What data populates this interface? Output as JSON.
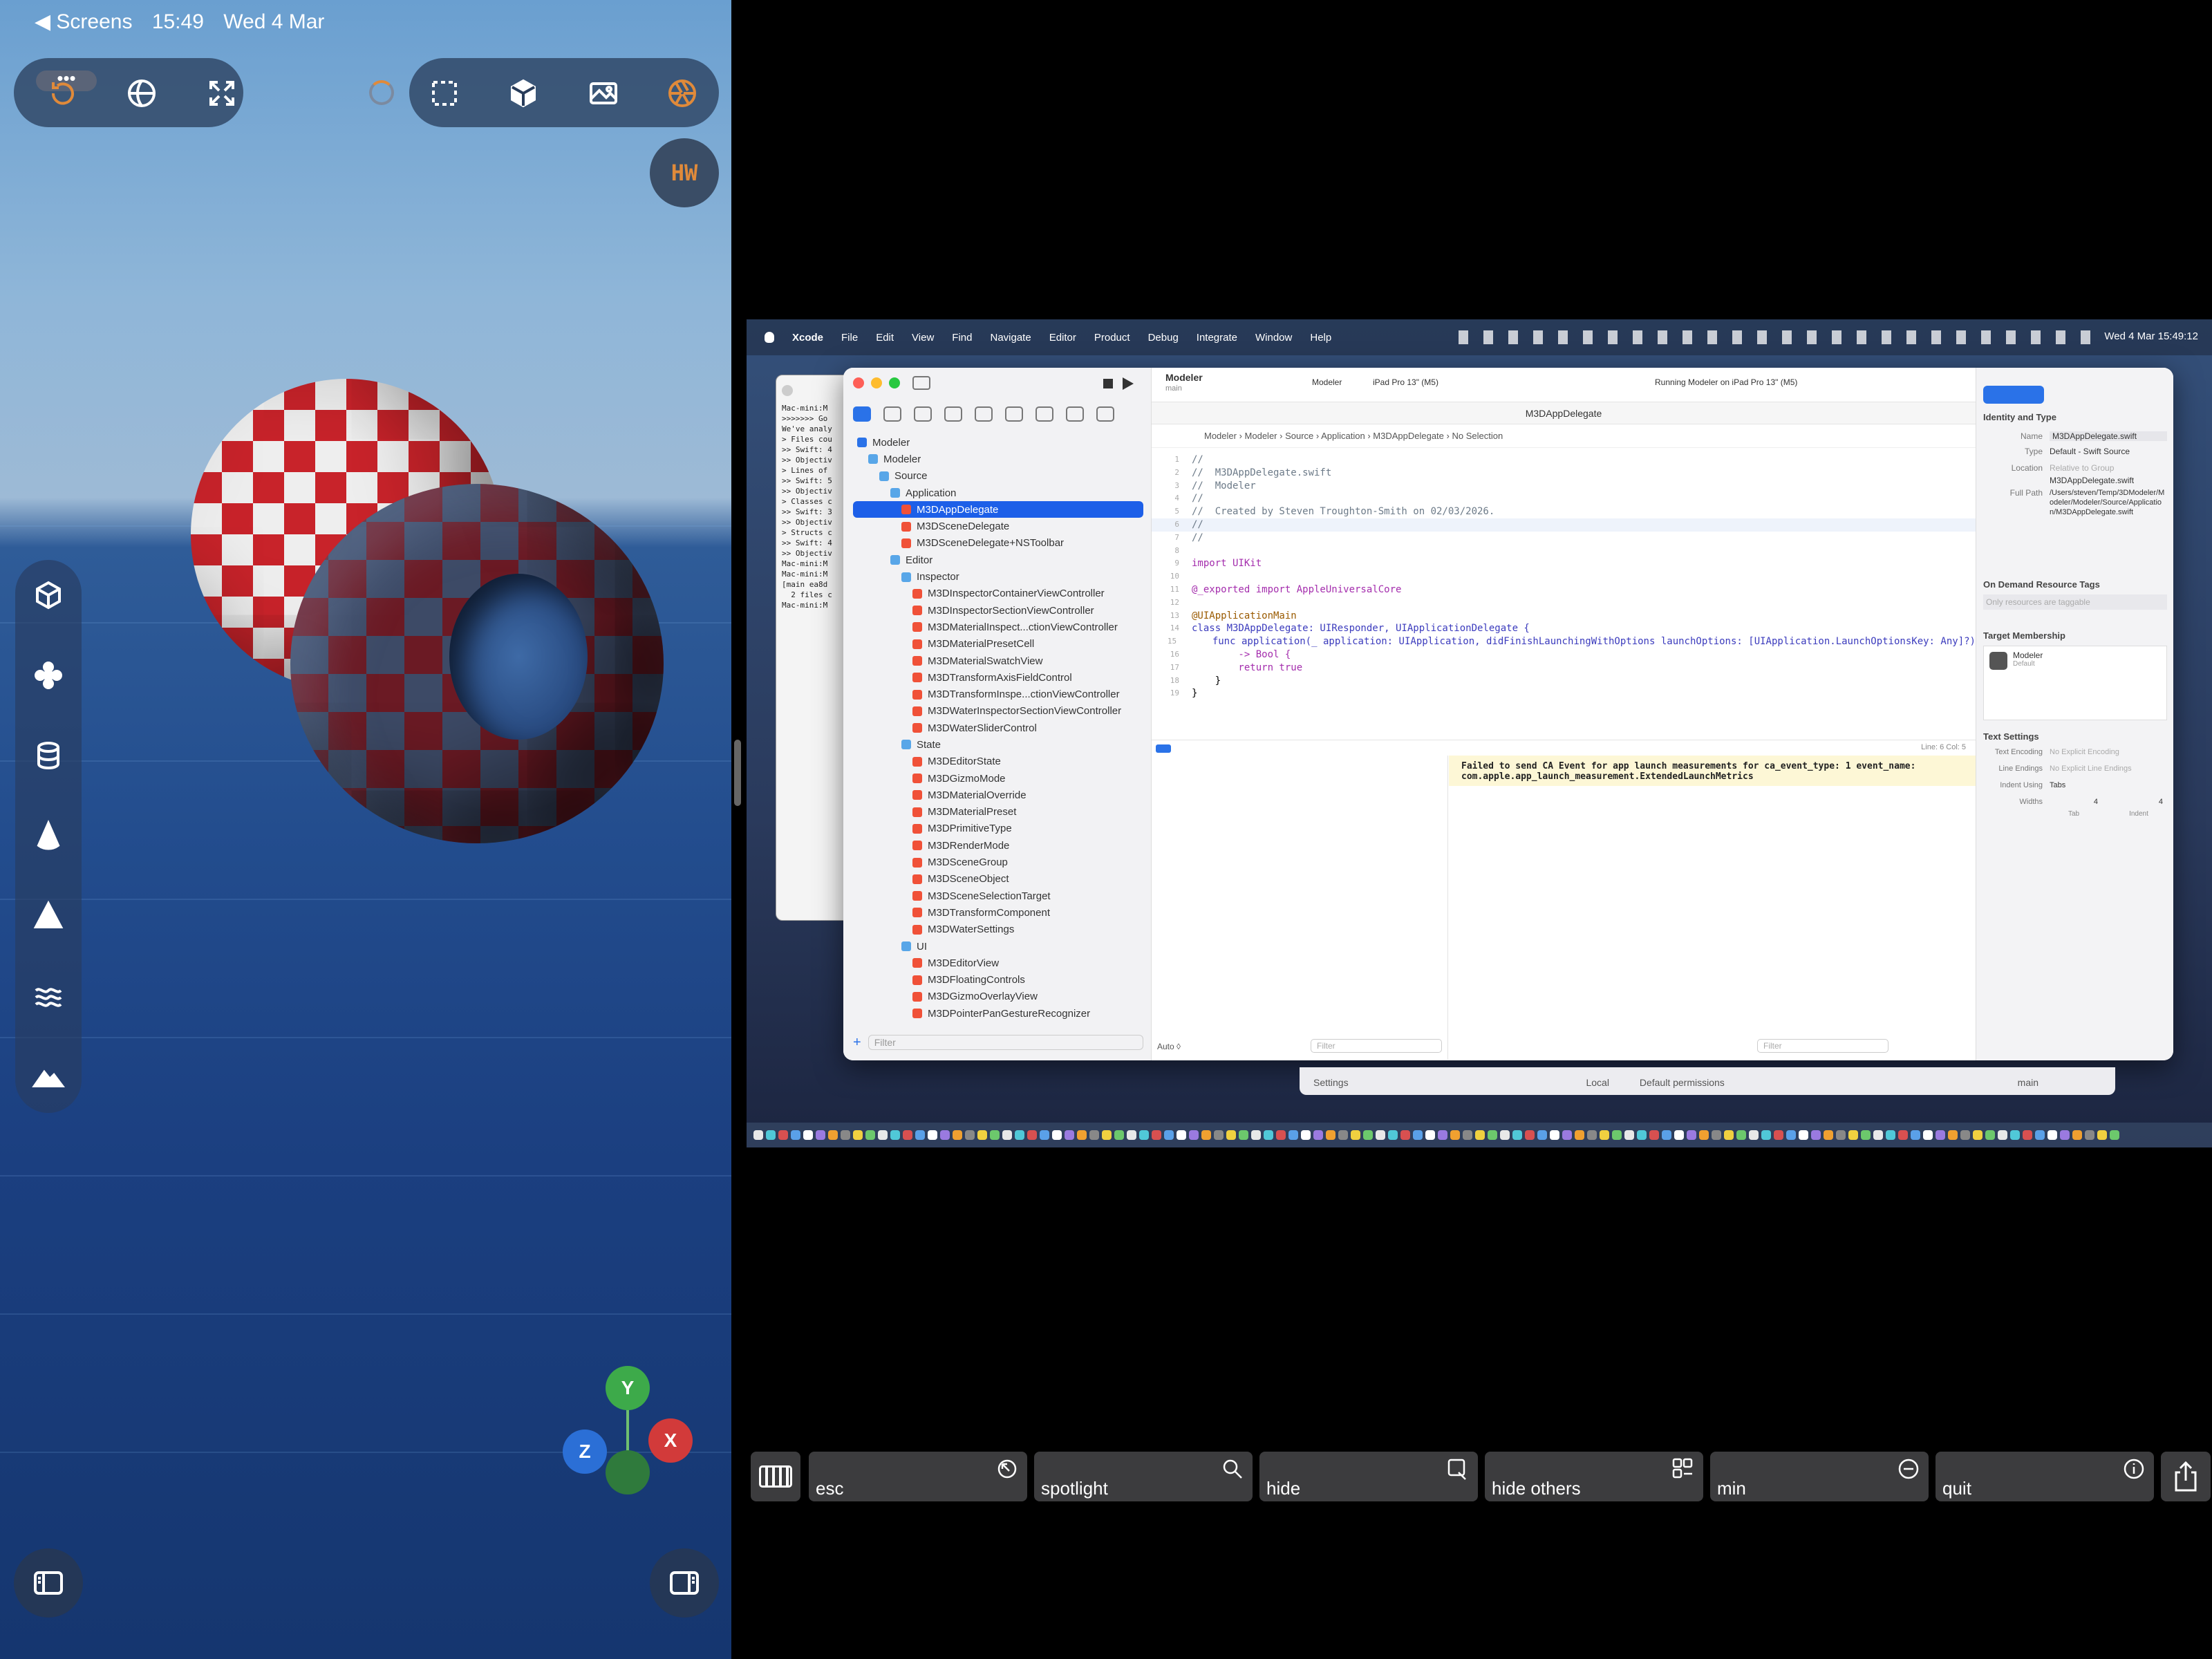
{
  "status_bar": {
    "back_app": "◀ Screens",
    "time": "15:49",
    "date": "Wed 4 Mar"
  },
  "viewport": {
    "avatar_initials": "HW",
    "axes": {
      "y": "Y",
      "x": "X",
      "z": "Z"
    }
  },
  "mac_menubar": {
    "apple": "",
    "items": [
      "Xcode",
      "File",
      "Edit",
      "View",
      "Find",
      "Navigate",
      "Editor",
      "Product",
      "Debug",
      "Integrate",
      "Window",
      "Help"
    ],
    "clock": "Wed 4 Mar 15:49:12"
  },
  "xcode": {
    "project": {
      "name": "Modeler",
      "branch": "main"
    },
    "scheme": "Modeler",
    "destination": "iPad Pro 13\" (M5)",
    "run_status": "Running Modeler on iPad Pro 13\" (M5)",
    "tab_title": "M3DAppDelegate",
    "jump_bar": [
      "Modeler",
      "Modeler",
      "Source",
      "Application",
      "M3DAppDelegate",
      "No Selection"
    ],
    "tree": [
      {
        "label": "Modeler",
        "depth": 0,
        "kind": "project"
      },
      {
        "label": "Modeler",
        "depth": 1,
        "kind": "folder"
      },
      {
        "label": "Source",
        "depth": 2,
        "kind": "folder"
      },
      {
        "label": "Application",
        "depth": 3,
        "kind": "folder"
      },
      {
        "label": "M3DAppDelegate",
        "depth": 4,
        "kind": "swift",
        "selected": true
      },
      {
        "label": "M3DSceneDelegate",
        "depth": 4,
        "kind": "swift"
      },
      {
        "label": "M3DSceneDelegate+NSToolbar",
        "depth": 4,
        "kind": "swift"
      },
      {
        "label": "Editor",
        "depth": 3,
        "kind": "folder"
      },
      {
        "label": "Inspector",
        "depth": 4,
        "kind": "folder"
      },
      {
        "label": "M3DInspectorContainerViewController",
        "depth": 5,
        "kind": "swift"
      },
      {
        "label": "M3DInspectorSectionViewController",
        "depth": 5,
        "kind": "swift"
      },
      {
        "label": "M3DMaterialInspect...ctionViewController",
        "depth": 5,
        "kind": "swift"
      },
      {
        "label": "M3DMaterialPresetCell",
        "depth": 5,
        "kind": "swift"
      },
      {
        "label": "M3DMaterialSwatchView",
        "depth": 5,
        "kind": "swift"
      },
      {
        "label": "M3DTransformAxisFieldControl",
        "depth": 5,
        "kind": "swift"
      },
      {
        "label": "M3DTransformInspe...ctionViewController",
        "depth": 5,
        "kind": "swift"
      },
      {
        "label": "M3DWaterInspectorSectionViewController",
        "depth": 5,
        "kind": "swift"
      },
      {
        "label": "M3DWaterSliderControl",
        "depth": 5,
        "kind": "swift"
      },
      {
        "label": "State",
        "depth": 4,
        "kind": "folder"
      },
      {
        "label": "M3DEditorState",
        "depth": 5,
        "kind": "swift"
      },
      {
        "label": "M3DGizmoMode",
        "depth": 5,
        "kind": "swift"
      },
      {
        "label": "M3DMaterialOverride",
        "depth": 5,
        "kind": "swift"
      },
      {
        "label": "M3DMaterialPreset",
        "depth": 5,
        "kind": "swift"
      },
      {
        "label": "M3DPrimitiveType",
        "depth": 5,
        "kind": "swift"
      },
      {
        "label": "M3DRenderMode",
        "depth": 5,
        "kind": "swift"
      },
      {
        "label": "M3DSceneGroup",
        "depth": 5,
        "kind": "swift"
      },
      {
        "label": "M3DSceneObject",
        "depth": 5,
        "kind": "swift"
      },
      {
        "label": "M3DSceneSelectionTarget",
        "depth": 5,
        "kind": "swift"
      },
      {
        "label": "M3DTransformComponent",
        "depth": 5,
        "kind": "swift"
      },
      {
        "label": "M3DWaterSettings",
        "depth": 5,
        "kind": "swift"
      },
      {
        "label": "UI",
        "depth": 4,
        "kind": "folder"
      },
      {
        "label": "M3DEditorView",
        "depth": 5,
        "kind": "swift"
      },
      {
        "label": "M3DFloatingControls",
        "depth": 5,
        "kind": "swift"
      },
      {
        "label": "M3DGizmoOverlayView",
        "depth": 5,
        "kind": "swift"
      },
      {
        "label": "M3DPointerPanGestureRecognizer",
        "depth": 5,
        "kind": "swift"
      }
    ],
    "filter_placeholder": "Filter",
    "code_lines": [
      {
        "n": "1",
        "t": "//",
        "c": "cm"
      },
      {
        "n": "2",
        "t": "//  M3DAppDelegate.swift",
        "c": "cm"
      },
      {
        "n": "3",
        "t": "//  Modeler",
        "c": "cm"
      },
      {
        "n": "4",
        "t": "//",
        "c": "cm"
      },
      {
        "n": "5",
        "t": "//  Created by Steven Troughton-Smith on 02/03/2026.",
        "c": "cm"
      },
      {
        "n": "6",
        "t": "//",
        "c": "cm"
      },
      {
        "n": "7",
        "t": "//",
        "c": "cm"
      },
      {
        "n": "8",
        "t": "",
        "c": ""
      },
      {
        "n": "9",
        "t": "import UIKit",
        "c": "kw"
      },
      {
        "n": "10",
        "t": "",
        "c": ""
      },
      {
        "n": "11",
        "t": "@_exported import AppleUniversalCore",
        "c": "kw"
      },
      {
        "n": "12",
        "t": "",
        "c": ""
      },
      {
        "n": "13",
        "t": "@UIApplicationMain",
        "c": "at"
      },
      {
        "n": "14",
        "t": "class M3DAppDelegate: UIResponder, UIApplicationDelegate {",
        "c": "ty"
      },
      {
        "n": "15",
        "t": "    func application(_ application: UIApplication, didFinishLaunchingWithOptions launchOptions: [UIApplication.LaunchOptionsKey: Any]?)",
        "c": "ty"
      },
      {
        "n": "16",
        "t": "        -> Bool {",
        "c": "kw"
      },
      {
        "n": "17",
        "t": "        return true",
        "c": "kw"
      },
      {
        "n": "18",
        "t": "    }",
        "c": ""
      },
      {
        "n": "19",
        "t": "}",
        "c": ""
      }
    ],
    "cursor_pos": "Line: 6  Col: 5",
    "console_message": "Failed to send CA Event for app launch measurements for ca_event_type: 1 event_name:\ncom.apple.app_launch_measurement.ExtendedLaunchMetrics",
    "debug_auto": "Auto ◊",
    "debug_filter": "Filter",
    "inspector": {
      "section_identity": "Identity and Type",
      "name_label": "Name",
      "name_value": "M3DAppDelegate.swift",
      "type_label": "Type",
      "type_value": "Default - Swift Source",
      "location_label": "Location",
      "location_value": "Relative to Group",
      "location_file": "M3DAppDelegate.swift",
      "fullpath_label": "Full Path",
      "fullpath_value": "/Users/steven/Temp/3DModeler/Modeler/Modeler/Source/Application/M3DAppDelegate.swift",
      "section_ondemand": "On Demand Resource Tags",
      "ondemand_placeholder": "Only resources are taggable",
      "section_target": "Target Membership",
      "target_name": "Modeler",
      "target_sub": "Default",
      "section_text": "Text Settings",
      "encoding_label": "Text Encoding",
      "encoding_value": "No Explicit Encoding",
      "endings_label": "Line Endings",
      "endings_value": "No Explicit Line Endings",
      "indent_label": "Indent Using",
      "indent_value": "Tabs",
      "widths_label": "Widths",
      "tab_width": "4",
      "indent_width": "4",
      "tab_caption": "Tab",
      "indent_caption": "Indent"
    },
    "settings_bar": {
      "title": "Settings",
      "local": "Local",
      "permissions": "Default permissions",
      "branch": "main"
    }
  },
  "terminal_lines": [
    "Mac-mini:M",
    ">>>>>>> Go",
    "",
    "We've analy",
    "",
    "> Files cou",
    ">> Swift: 4",
    ">> Objectiv",
    "",
    "> Lines of",
    ">> Swift: 5",
    ">> Objectiv",
    "",
    "> Classes c",
    ">> Swift: 3",
    ">> Objectiv",
    "",
    "> Structs c",
    ">> Swift: 4",
    ">> Objectiv",
    "Mac-mini:M",
    "Mac-mini:M",
    "[main ea8d",
    "  2 files c",
    "Mac-mini:M"
  ],
  "keys": [
    "esc",
    "spotlight",
    "hide",
    "hide others",
    "min",
    "quit"
  ],
  "colors": {
    "accent": "#1d5fe8",
    "brand_orange": "#e08a3a",
    "checker_red": "#c8232a"
  }
}
